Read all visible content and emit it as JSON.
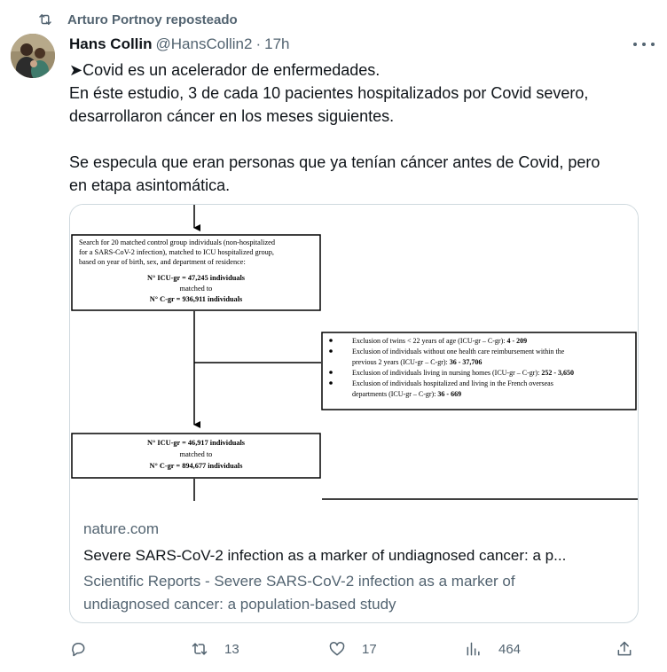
{
  "repost": {
    "text": "Arturo Portnoy reposteado",
    "icon": "repost-icon"
  },
  "tweet": {
    "author_name": "Hans Collin",
    "handle": "@HansCollin2",
    "separator": "·",
    "time": "17h",
    "lines": [
      "➤Covid es un acelerador de enfermedades.",
      "En éste estudio, 3 de cada 10 pacientes hospitalizados por Covid severo,",
      "desarrollaron cáncer en los meses siguientes.",
      "Se especula que eran personas que ya tenían cáncer antes de Covid, pero",
      "en etapa asintomática."
    ]
  },
  "figure": {
    "box1": [
      "Search for 20 matched control group individuals (non-hospitalized",
      "for a SARS-CoV-2 infection), matched to ICU hospitalized group,",
      "based on year of birth, sex, and department of residence:",
      "N° ICU-gr = 47,245 individuals",
      "matched to",
      "N° C-gr = 936,911 individuals"
    ],
    "exclusions": [
      {
        "text": "Exclusion of twins < 22 years of age (ICU-gr – C-gr): ",
        "value": "4 - 209"
      },
      {
        "text": "Exclusion of individuals without one health care reimbursement within the",
        "cont": "previous 2 years (ICU-gr – C-gr): ",
        "value": "36 - 37,706"
      },
      {
        "text": "Exclusion of individuals living in nursing homes (ICU-gr – C-gr): ",
        "value": "252 - 3,650"
      },
      {
        "text": "Exclusion of individuals hospitalized and living in the French overseas",
        "cont": "departments (ICU-gr – C-gr): ",
        "value": "36 - 669"
      }
    ],
    "box2": [
      "N° ICU-gr = 46,917 individuals",
      "matched to",
      "N° C-gr = 894,677 individuals"
    ]
  },
  "card": {
    "domain": "nature.com",
    "title": "Severe SARS-CoV-2 infection as a marker of undiagnosed cancer: a p...",
    "desc_line1": "Scientific Reports - Severe SARS-CoV-2 infection as a marker of",
    "desc_line2": "undiagnosed cancer: a population-based study"
  },
  "actions": {
    "reply": {
      "icon": "reply-icon",
      "count": ""
    },
    "retweet": {
      "icon": "retweet-icon",
      "count": "13"
    },
    "like": {
      "icon": "heart-icon",
      "count": "17"
    },
    "views": {
      "icon": "views-icon",
      "count": "464"
    },
    "share": {
      "icon": "share-icon"
    }
  },
  "colors": {
    "text": "#0f1419",
    "secondary": "#536471",
    "border": "#cfd9de"
  }
}
